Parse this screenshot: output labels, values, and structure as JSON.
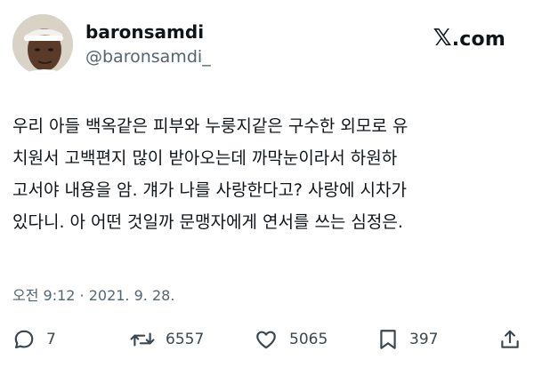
{
  "tweet": {
    "display_name": "baronsamdi",
    "handle": "@baronsamdi_",
    "brand": {
      "mark": "𝕏",
      "suffix": ".com"
    },
    "text_lines": [
      "우리 아들 백옥같은 피부와 누룽지같은 구수한 외모로 유",
      "치원서 고백편지 많이 받아오는데 까막눈이라서 하원하",
      "고서야 내용을 암. 걔가 나를 사랑한다고? 사랑에 시차가",
      "있다니. 아 어떤 것일까 문맹자에게 연서를 쓰는 심정은."
    ],
    "timestamp": "오전 9:12 · 2021. 9. 28.",
    "metrics": {
      "replies": "7",
      "retweets": "6557",
      "likes": "5065",
      "bookmarks": "397"
    }
  },
  "icons": {
    "reply": "reply-icon",
    "retweet": "retweet-icon",
    "like": "heart-icon",
    "bookmark": "bookmark-icon",
    "share": "share-icon"
  },
  "colors": {
    "text": "#0f1419",
    "secondary": "#536471",
    "icon": "#3b4651"
  }
}
